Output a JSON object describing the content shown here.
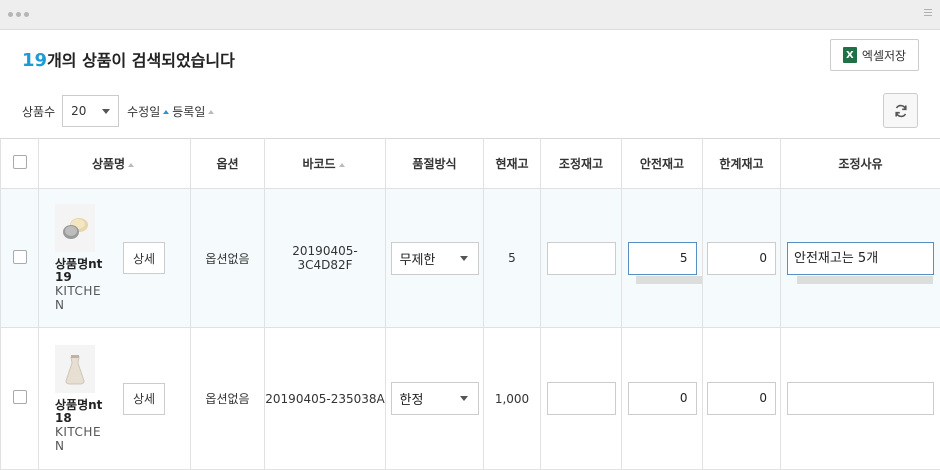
{
  "window": {},
  "header": {
    "count_number": "19",
    "count_suffix": "개의 상품이 검색되었습니다",
    "excel_button": "엑셀저장",
    "excel_icon_letter": "X"
  },
  "filters": {
    "count_label": "상품수",
    "page_size": "20",
    "sort_modified": "수정일",
    "sort_registered": "등록일"
  },
  "columns": {
    "product_name": "상품명",
    "option": "옵션",
    "barcode": "바코드",
    "soldout_method": "품절방식",
    "current_stock": "현재고",
    "adjust_stock": "조정재고",
    "safety_stock": "안전재고",
    "limit_stock": "한계재고",
    "adjust_reason": "조정사유"
  },
  "rows": [
    {
      "name": "상품명nt 19",
      "name_line1": "상품명nt",
      "name_line2": "19",
      "category_line1": "KITCHE",
      "category_line2": "N",
      "detail_button": "상세",
      "option": "옵션없음",
      "barcode": "20190405-3C4D82F",
      "soldout_method": "무제한",
      "current_stock": "5",
      "adjust_stock": "",
      "safety_stock": "5",
      "limit_stock": "0",
      "adjust_reason": "안전재고는 5개"
    },
    {
      "name": "상품명nt 18",
      "name_line1": "상품명nt",
      "name_line2": "18",
      "category_line1": "KITCHE",
      "category_line2": "N",
      "detail_button": "상세",
      "option": "옵션없음",
      "barcode": "20190405-235038A",
      "soldout_method": "한정",
      "current_stock": "1,000",
      "adjust_stock": "",
      "safety_stock": "0",
      "limit_stock": "0",
      "adjust_reason": ""
    }
  ],
  "colors": {
    "accent": "#1e9ad6",
    "selected_row": "#f5fbfd",
    "excel_green": "#1f7145"
  }
}
